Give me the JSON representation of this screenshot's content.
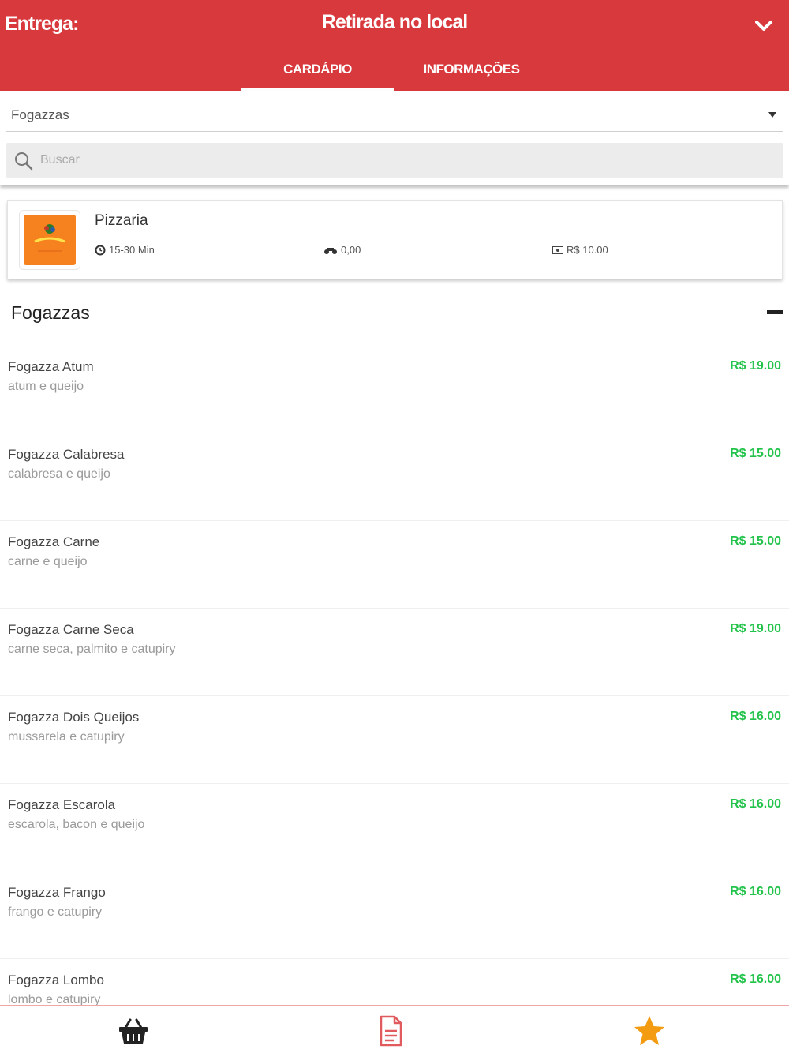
{
  "header": {
    "delivery_label": "Entrega:",
    "mode": "Retirada no local"
  },
  "tabs": [
    {
      "label": "CARDÁPIO",
      "active": true
    },
    {
      "label": "INFORMAÇÕES",
      "active": false
    }
  ],
  "filter": {
    "category_selected": "Fogazzas",
    "search_placeholder": "Buscar"
  },
  "store": {
    "name": "Pizzaria",
    "time": "15-30 Min",
    "delivery_fee": "0,00",
    "min_order": "R$ 10.00"
  },
  "category": {
    "title": "Fogazzas",
    "items": [
      {
        "name": "Fogazza Atum",
        "desc": "atum e queijo",
        "price": "R$ 19.00"
      },
      {
        "name": "Fogazza Calabresa",
        "desc": "calabresa e queijo",
        "price": "R$ 15.00"
      },
      {
        "name": "Fogazza Carne",
        "desc": "carne e queijo",
        "price": "R$ 15.00"
      },
      {
        "name": "Fogazza Carne Seca",
        "desc": "carne seca, palmito e catupiry",
        "price": "R$ 19.00"
      },
      {
        "name": "Fogazza Dois Queijos",
        "desc": "mussarela e catupiry",
        "price": "R$ 16.00"
      },
      {
        "name": "Fogazza Escarola",
        "desc": "escarola, bacon e queijo",
        "price": "R$ 16.00"
      },
      {
        "name": "Fogazza Frango",
        "desc": "frango e catupiry",
        "price": "R$ 16.00"
      },
      {
        "name": "Fogazza Lombo",
        "desc": "lombo e catupiry",
        "price": "R$ 16.00"
      }
    ]
  },
  "colors": {
    "brand": "#d8393d",
    "price": "#22c34a",
    "star": "#f39c12"
  },
  "icons": {
    "bottom_nav": [
      "basket-icon",
      "document-icon",
      "star-icon"
    ]
  }
}
